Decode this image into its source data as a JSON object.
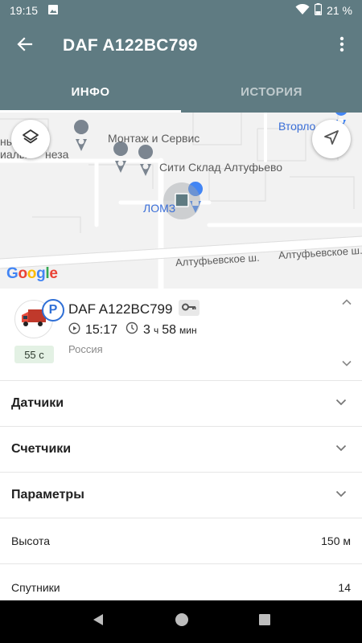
{
  "status_bar": {
    "time": "19:15",
    "battery": "21 %"
  },
  "app_bar": {
    "title": "DAF A122BC799"
  },
  "tabs": [
    {
      "label": "ИНФО",
      "active": true
    },
    {
      "label": "ИСТОРИЯ",
      "active": false
    }
  ],
  "map": {
    "labels": {
      "montazh": "Монтаж и Сервис",
      "left_cut1": "ные",
      "left_cut2": "иалы",
      "neza": "неза",
      "siti": "Сити Склад Алтуфьево",
      "vtorlo": "Вторло",
      "lomz": "ЛОМЗ",
      "street1": "Алтуфьевское ш.",
      "street2": "Алтуфьевское ш."
    },
    "brand": "Google",
    "accent_blue": "#4285f4"
  },
  "vehicle": {
    "name": "DAF A122BC799",
    "parking_badge": "P",
    "speed": "55 с",
    "time": "15:17",
    "duration_hours": "3",
    "duration_hours_unit": "ч",
    "duration_minutes": "58",
    "duration_minutes_unit": "мин",
    "country": "Россия"
  },
  "sections": [
    {
      "label": "Датчики"
    },
    {
      "label": "Счетчики"
    },
    {
      "label": "Параметры"
    }
  ],
  "parameters": [
    {
      "label": "Высота",
      "value": "150 м"
    },
    {
      "label": "Спутники",
      "value": "14"
    }
  ],
  "colors": {
    "primary": "#5f7b82",
    "badge_blue": "#2f6fd6",
    "speed_bg": "#e3f1e4"
  }
}
